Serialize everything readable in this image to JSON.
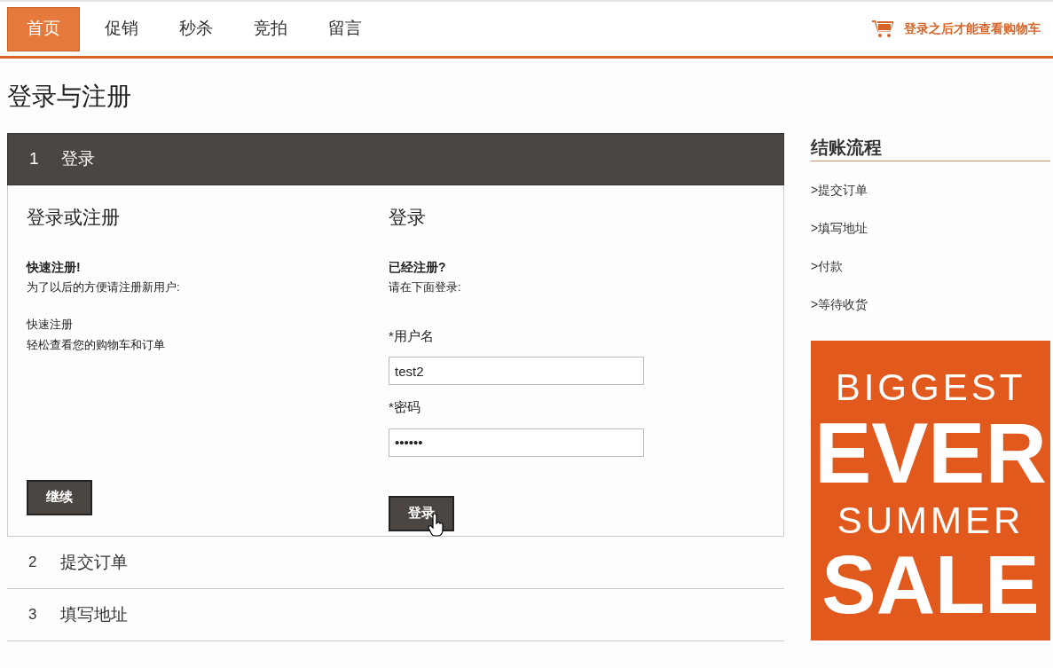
{
  "nav": {
    "tabs": [
      {
        "label": "首页",
        "selected": true
      },
      {
        "label": "促销",
        "selected": false
      },
      {
        "label": "秒杀",
        "selected": false
      },
      {
        "label": "竞拍",
        "selected": false
      },
      {
        "label": "留言",
        "selected": false
      }
    ],
    "cart_text": "登录之后才能查看购物车"
  },
  "page_title": "登录与注册",
  "steps": [
    {
      "number": "1",
      "title": "登录",
      "expanded": true
    },
    {
      "number": "2",
      "title": "提交订单",
      "expanded": false
    },
    {
      "number": "3",
      "title": "填写地址",
      "expanded": false
    }
  ],
  "login_panel": {
    "left": {
      "heading": "登录或注册",
      "subheading": "快速注册!",
      "intro": "为了以后的方便请注册新用户:",
      "benefit_title": "快速注册",
      "benefit_text": "轻松查看您的购物车和订单",
      "button": "继续"
    },
    "right": {
      "heading": "登录",
      "subheading": "已经注册?",
      "intro": "请在下面登录:",
      "username_label": "*用户名",
      "username_value": "test2",
      "password_label": "*密码",
      "password_value": "••••••",
      "button": "登录"
    }
  },
  "sidebar": {
    "title": "结账流程",
    "items": [
      ">提交订单",
      ">填写地址",
      ">付款",
      ">等待收货"
    ],
    "banner": {
      "lines": [
        "BIGGEST",
        "EVER",
        "SUMMER",
        "SALE"
      ]
    }
  }
}
